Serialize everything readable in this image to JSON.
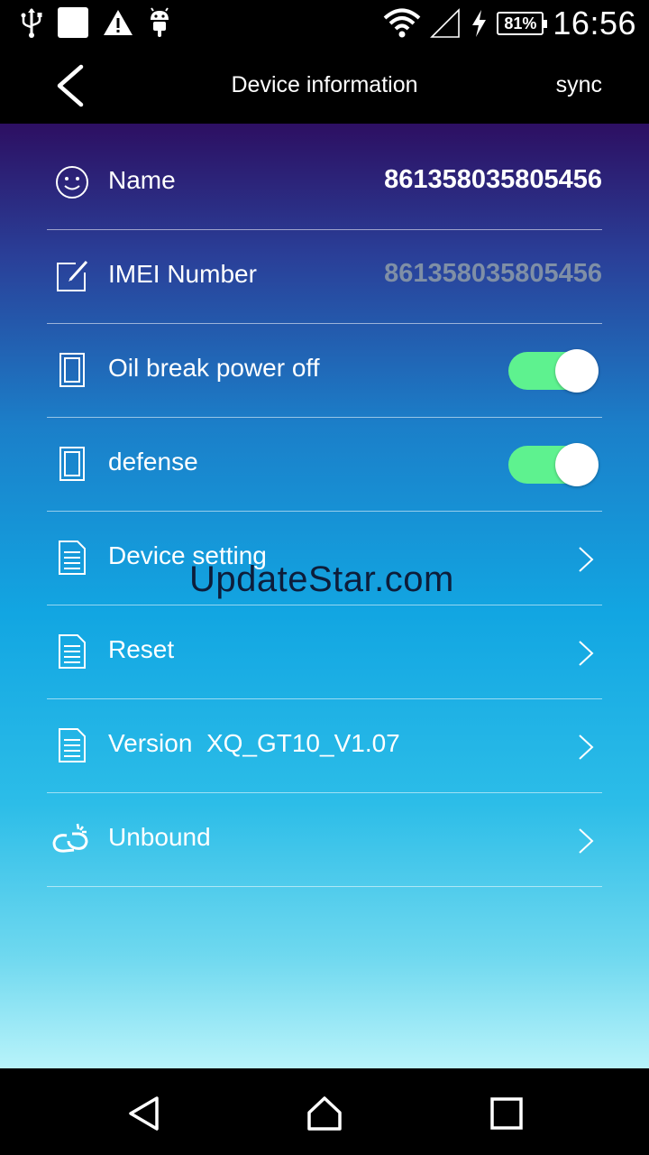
{
  "status_bar": {
    "icons": [
      "usb-icon",
      "blank-notification-icon",
      "warning-icon",
      "android-icon",
      "wifi-icon",
      "signal-icon",
      "charging-icon"
    ],
    "battery": "81%",
    "time": "16:56"
  },
  "app_bar": {
    "title": "Device information",
    "action": "sync"
  },
  "rows": [
    {
      "icon": "smiley-icon",
      "label": "Name",
      "value": "861358035805456"
    },
    {
      "icon": "edit-icon",
      "label": "IMEI Number",
      "value": "861358035805456"
    },
    {
      "icon": "door-icon",
      "label": "Oil break power off",
      "toggle_on": true
    },
    {
      "icon": "door-icon",
      "label": "defense",
      "toggle_on": true
    },
    {
      "icon": "document-icon",
      "label": "Device setting"
    },
    {
      "icon": "document-icon",
      "label": "Reset"
    },
    {
      "icon": "document-icon",
      "label": "Version  XQ_GT10_V1.07"
    },
    {
      "icon": "link-icon",
      "label": "Unbound"
    }
  ],
  "watermark": "UpdateStar.com",
  "colors": {
    "toggle_on": "#5ef28f",
    "gradient_top": "#2d0f62",
    "gradient_bottom": "#b8f3fa",
    "dim_value": "#7f8fa6"
  },
  "nav_bar": {
    "icons": [
      "back-triangle-icon",
      "home-icon",
      "recents-icon"
    ]
  }
}
